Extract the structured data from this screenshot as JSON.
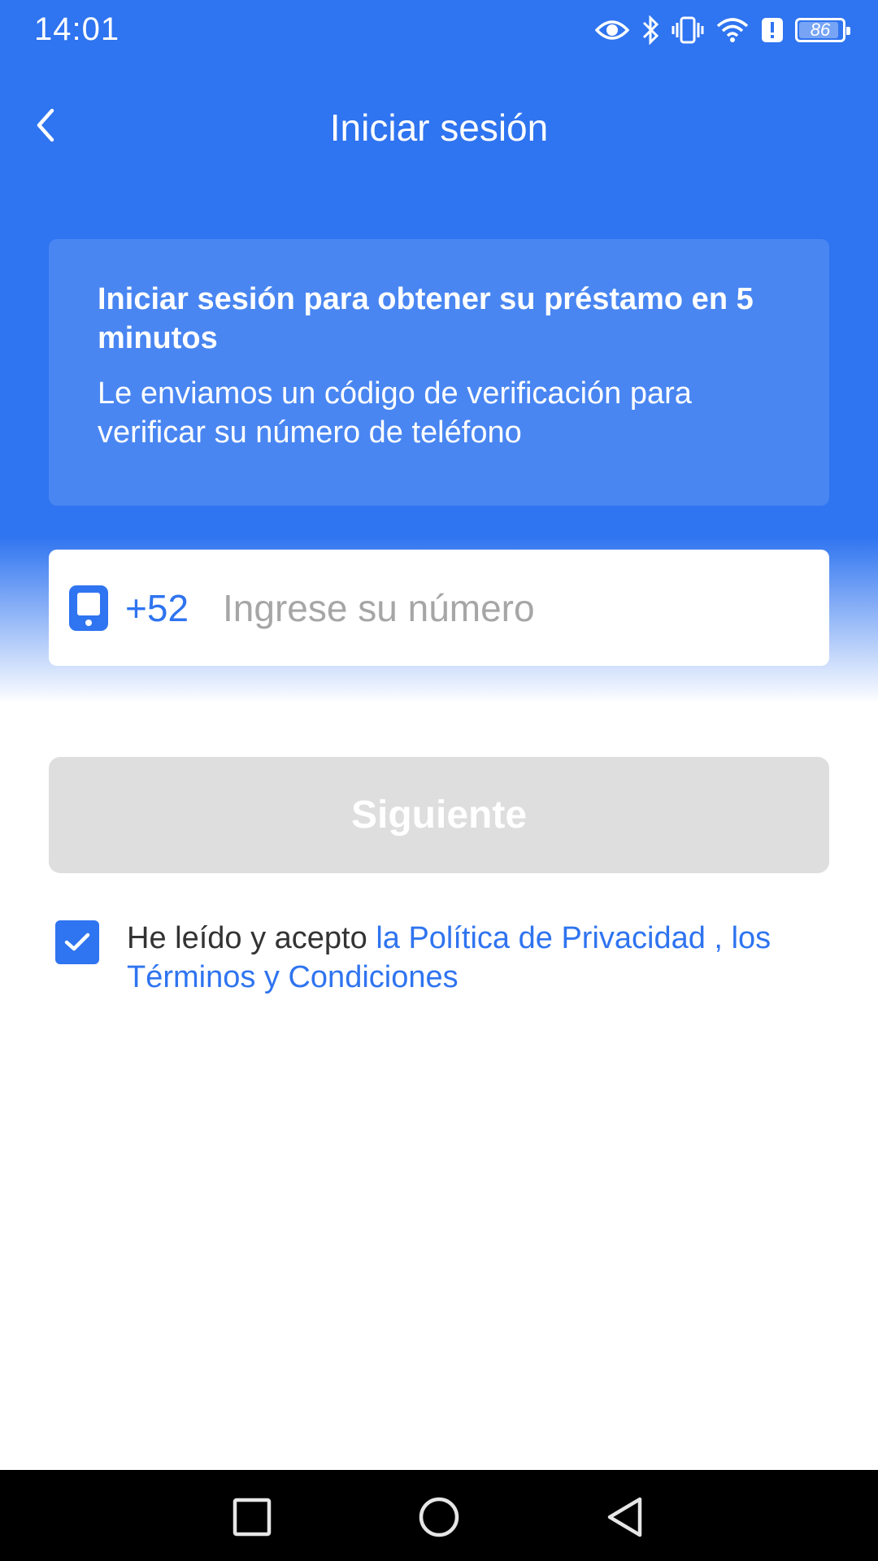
{
  "status_bar": {
    "time": "14:01",
    "battery_level": "86",
    "battery_fraction": 0.86,
    "icons": [
      "eye-icon",
      "bluetooth-icon",
      "vibrate-icon",
      "wifi-icon",
      "alert-icon",
      "battery-icon"
    ]
  },
  "header": {
    "title": "Iniciar sesión",
    "back_icon": "chevron-left-icon"
  },
  "info_card": {
    "heading": "Iniciar sesión para obtener su préstamo en 5 minutos",
    "body": "Le enviamos un código de verificación para verificar su número de teléfono"
  },
  "phone_field": {
    "icon": "phone-icon",
    "country_code": "+52",
    "placeholder": "Ingrese su número",
    "value": ""
  },
  "next_button": {
    "label": "Siguiente",
    "enabled": false
  },
  "agreement": {
    "checked": true,
    "prefix": "He leído y acepto ",
    "privacy_link": "la Política de Privacidad",
    "separator": " , ",
    "terms_link": "los Términos y Condiciones"
  },
  "android_nav": {
    "buttons": [
      "recents-button",
      "home-button",
      "back-button"
    ]
  },
  "colors": {
    "primary": "#2f74f0",
    "disabled_button": "#dedede",
    "placeholder": "#a6a6a6"
  }
}
